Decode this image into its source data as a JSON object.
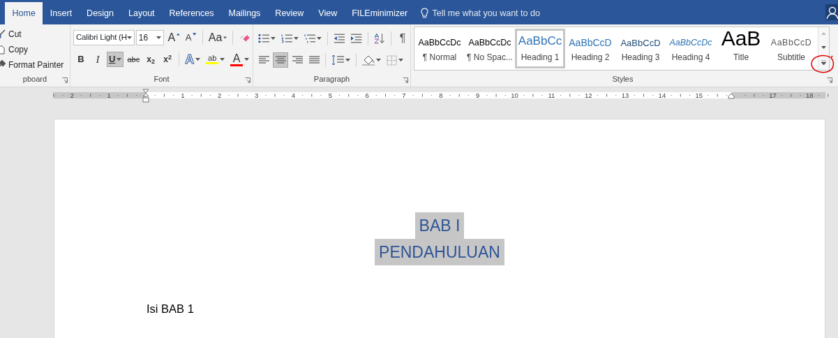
{
  "tabs": [
    {
      "label": "Home",
      "selected": true
    },
    {
      "label": "Insert",
      "selected": false
    },
    {
      "label": "Design",
      "selected": false
    },
    {
      "label": "Layout",
      "selected": false
    },
    {
      "label": "References",
      "selected": false
    },
    {
      "label": "Mailings",
      "selected": false
    },
    {
      "label": "Review",
      "selected": false
    },
    {
      "label": "View",
      "selected": false
    },
    {
      "label": "FILEminimizer",
      "selected": false
    }
  ],
  "tell_me": {
    "placeholder": "Tell me what you want to do"
  },
  "clipboard": {
    "label": "pboard",
    "items": [
      {
        "label": "Cut",
        "kind": "cut"
      },
      {
        "label": "Copy",
        "kind": "copy"
      },
      {
        "label": "Format Painter",
        "kind": "painter"
      }
    ]
  },
  "font": {
    "label": "Font",
    "name": "Calibri Light (H",
    "size": "16",
    "row1": [
      {
        "kind": "grow",
        "label": "A"
      },
      {
        "kind": "shrink",
        "label": "A"
      },
      {
        "kind": "case",
        "label": "Aa"
      },
      {
        "kind": "clear"
      }
    ],
    "row2": [
      {
        "kind": "bold",
        "label": "B",
        "on": false
      },
      {
        "kind": "italic",
        "label": "I",
        "on": false
      },
      {
        "kind": "underline",
        "label": "U",
        "on": true
      },
      {
        "kind": "strike",
        "label": "abc",
        "on": false
      },
      {
        "kind": "subscript",
        "label": "x$_{2}$",
        "on": false
      },
      {
        "kind": "superscript",
        "label": "x$^{2}$",
        "on": false
      },
      {
        "kind": "effects",
        "label": "A",
        "on": false
      },
      {
        "kind": "highlight",
        "label": "ab",
        "color": "#ffff00",
        "on": false
      },
      {
        "kind": "fontcolor",
        "label": "A",
        "color": "#ff0000",
        "on": false
      }
    ]
  },
  "paragraph": {
    "label": "Paragraph",
    "row1": [
      {
        "kind": "bullets"
      },
      {
        "kind": "numbering"
      },
      {
        "kind": "multilevel"
      },
      {
        "kind": "outdent"
      },
      {
        "kind": "indent"
      },
      {
        "kind": "sort"
      },
      {
        "kind": "marks",
        "label": "¶"
      }
    ],
    "row2": [
      {
        "kind": "left",
        "selected": false
      },
      {
        "kind": "center",
        "selected": true
      },
      {
        "kind": "right",
        "selected": false
      },
      {
        "kind": "justify",
        "selected": false
      },
      {
        "kind": "spacing"
      },
      {
        "kind": "shading"
      },
      {
        "kind": "borders"
      }
    ]
  },
  "styles": {
    "label": "Styles",
    "items": [
      {
        "kind": "normal",
        "preview": "AaBbCcDc",
        "name": "¶ Normal",
        "selected": false
      },
      {
        "kind": "nospacing",
        "preview": "AaBbCcDc",
        "name": "¶ No Spac...",
        "selected": false
      },
      {
        "kind": "heading1",
        "preview": "AaBbCc",
        "name": "Heading 1",
        "selected": true
      },
      {
        "kind": "heading2",
        "preview": "AaBbCcD",
        "name": "Heading 2",
        "selected": false
      },
      {
        "kind": "heading3",
        "preview": "AaBbCcD",
        "name": "Heading 3",
        "selected": false
      },
      {
        "kind": "heading4",
        "preview": "AaBbCcDc",
        "name": "Heading 4",
        "selected": false
      },
      {
        "kind": "title",
        "preview": "AaB",
        "name": "Title",
        "selected": false
      },
      {
        "kind": "subtitle",
        "preview": "AaBbCcD",
        "name": "Subtitle",
        "selected": false
      }
    ]
  },
  "ruler": {
    "left_numbers": [
      "2",
      "1"
    ],
    "right_numbers": [
      "1",
      "2",
      "3",
      "4",
      "5",
      "6",
      "7",
      "8",
      "9",
      "10",
      "11",
      "12",
      "13",
      "14",
      "15",
      "17",
      "18"
    ]
  },
  "document": {
    "heading_lines": [
      "BAB I",
      "PENDAHULUAN"
    ],
    "body": "Isi BAB 1"
  }
}
